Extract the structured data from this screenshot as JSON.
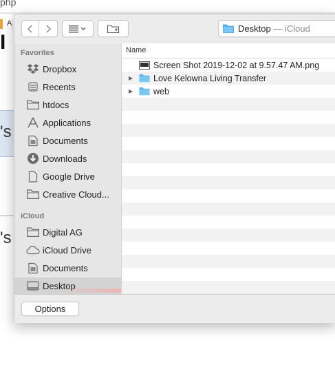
{
  "background": {
    "url_fragment": "php",
    "tab_label": "A",
    "heading_fragment": "I",
    "text_fragment_1": "'s",
    "text_fragment_2": "'s"
  },
  "toolbar": {
    "back_icon": "chevron-left-icon",
    "forward_icon": "chevron-right-icon",
    "view_icon": "list-view-icon",
    "new_folder_icon": "new-folder-icon",
    "location_folder": "Desktop",
    "location_suffix": "— iCloud"
  },
  "sidebar": {
    "favorites_header": "Favorites",
    "favorites": [
      {
        "label": "Dropbox",
        "icon": "dropbox-icon"
      },
      {
        "label": "Recents",
        "icon": "recents-icon"
      },
      {
        "label": "htdocs",
        "icon": "folder-icon"
      },
      {
        "label": "Applications",
        "icon": "applications-icon"
      },
      {
        "label": "Documents",
        "icon": "documents-icon"
      },
      {
        "label": "Downloads",
        "icon": "downloads-icon"
      },
      {
        "label": "Google Drive",
        "icon": "document-icon"
      },
      {
        "label": "Creative Cloud...",
        "icon": "folder-icon"
      }
    ],
    "icloud_header": "iCloud",
    "icloud": [
      {
        "label": "Digital AG",
        "icon": "folder-icon"
      },
      {
        "label": "iCloud Drive",
        "icon": "cloud-icon"
      },
      {
        "label": "Documents",
        "icon": "documents-icon"
      },
      {
        "label": "Desktop",
        "icon": "desktop-icon",
        "selected": true
      }
    ]
  },
  "file_list": {
    "column_name": "Name",
    "items": [
      {
        "name": "Screen Shot 2019-12-02 at 9.57.47 AM.png",
        "type": "image",
        "expandable": false
      },
      {
        "name": "Love Kelowna Living Transfer",
        "type": "folder",
        "expandable": true
      },
      {
        "name": "web",
        "type": "folder",
        "expandable": true
      }
    ]
  },
  "bottom": {
    "options_label": "Options"
  },
  "colors": {
    "folder_blue": "#5ab4ee",
    "sidebar_bg": "#e6e6e6",
    "selected_bg": "#d3d3d3"
  }
}
